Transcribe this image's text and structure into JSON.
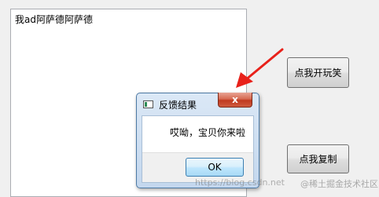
{
  "editor": {
    "text": "我ad阿萨德阿萨德"
  },
  "buttons": {
    "joke": "点我开玩笑",
    "copy": "点我复制"
  },
  "dialog": {
    "title": "反馈结果",
    "close": "x",
    "message": "哎呦，宝贝你来啦",
    "ok": "OK"
  },
  "watermark": {
    "url": "https://blog.csdn.net",
    "brand": "@稀土掘金技术社区"
  },
  "colors": {
    "arrow": "#e8211a",
    "close_button": "#c74a32",
    "ok_border": "#3c7fb1"
  }
}
